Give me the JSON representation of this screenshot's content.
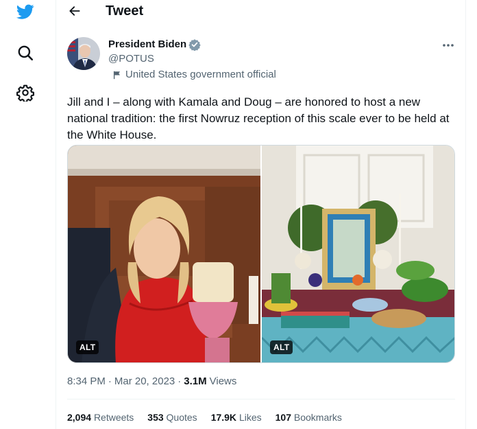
{
  "sidebar": {
    "items": [
      {
        "icon": "twitter-logo-icon"
      },
      {
        "icon": "search-icon"
      },
      {
        "icon": "gear-icon"
      }
    ]
  },
  "header": {
    "title": "Tweet"
  },
  "author": {
    "name": "President Biden",
    "handle": "@POTUS",
    "label": "United States government official",
    "verified_color": "#829aab"
  },
  "tweet": {
    "text": "Jill and I – along with Kamala and Doug – are honored to host a new national tradition: the first Nowruz reception of this scale ever to be held at the White House.",
    "media": [
      {
        "alt_badge": "ALT"
      },
      {
        "alt_badge": "ALT"
      }
    ],
    "time": "8:34 PM",
    "date": "Mar 20, 2023",
    "separator": "·",
    "views_count": "3.1M",
    "views_label": "Views"
  },
  "stats": {
    "retweets_count": "2,094",
    "retweets_label": "Retweets",
    "quotes_count": "353",
    "quotes_label": "Quotes",
    "likes_count": "17.9K",
    "likes_label": "Likes",
    "bookmarks_count": "107",
    "bookmarks_label": "Bookmarks"
  },
  "colors": {
    "brand": "#1d9bf0",
    "text_primary": "#0f1419",
    "text_secondary": "#536471",
    "border": "#eff3f4"
  }
}
